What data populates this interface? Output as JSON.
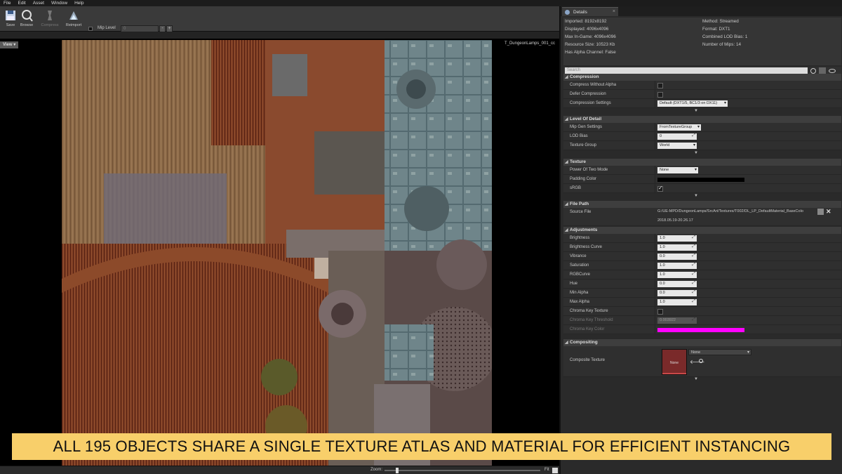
{
  "menu": [
    "File",
    "Edit",
    "Asset",
    "Window",
    "Help"
  ],
  "toolbar": {
    "save": "Save",
    "browse": "Browse",
    "compress": "Compress",
    "reimport": "Reimport",
    "mip_level_label": "Mip Level",
    "mip_level_value": "0"
  },
  "viewport": {
    "view_button": "View",
    "texture_name": "T_DungeonLamps_001_cc",
    "zoom_label": "Zoom:",
    "fit_label": "Fit"
  },
  "details": {
    "tab_label": "Details",
    "info": {
      "imported": "Imported: 8192x8192",
      "displayed": "Displayed: 4096x4096",
      "max_ingame": "Max In-Game: 4096x4096",
      "resource_size": "Resource Size: 10523 Kb",
      "has_alpha": "Has Alpha Channel: False",
      "method": "Method: Streamed",
      "format": "Format: DXT1",
      "lod_bias": "Combined LOD Bias: 1",
      "mips": "Number of Mips: 14"
    },
    "search_placeholder": "Search",
    "compression": {
      "title": "Compression",
      "compress_without_alpha": "Compress Without Alpha",
      "defer_compression": "Defer Compression",
      "compression_settings": "Compression Settings",
      "compression_settings_value": "Default (DXT1/5, BC1/3 on DX11)"
    },
    "lod": {
      "title": "Level Of Detail",
      "mip_gen": "Mip Gen Settings",
      "mip_gen_value": "FromTextureGroup",
      "lod_bias": "LOD Bias",
      "lod_bias_value": "0",
      "texture_group": "Texture Group",
      "texture_group_value": "World"
    },
    "texture": {
      "title": "Texture",
      "power_of_two": "Power Of Two Mode",
      "power_of_two_value": "None",
      "padding_color": "Padding Color",
      "srgb": "sRGB"
    },
    "file_path": {
      "title": "File Path",
      "source_file": "Source File",
      "path": "G:/UE-MPD/DungeonLamps/SrcArt/Textures/T002/DL_LP_DefaultMaterial_BaseColo",
      "date": "2018.05.19-20.26.17"
    },
    "adjustments": {
      "title": "Adjustments",
      "rows": [
        {
          "label": "Brightness",
          "value": "1.0"
        },
        {
          "label": "Brightness Curve",
          "value": "1.0"
        },
        {
          "label": "Vibrance",
          "value": "0.0"
        },
        {
          "label": "Saturation",
          "value": "1.0"
        },
        {
          "label": "RGBCurve",
          "value": "1.0"
        },
        {
          "label": "Hue",
          "value": "0.0"
        },
        {
          "label": "Min Alpha",
          "value": "0.0"
        },
        {
          "label": "Max Alpha",
          "value": "1.0"
        }
      ],
      "chroma_key_texture": "Chroma Key Texture",
      "chroma_key_threshold": "Chroma Key Threshold",
      "chroma_key_threshold_value": "0.003922",
      "chroma_key_color": "Chroma Key Color"
    },
    "compositing": {
      "title": "Compositing",
      "composite_texture": "Composite Texture",
      "thumb_label": "None",
      "combo_value": "None"
    }
  },
  "colors": {
    "padding_color": "#000000",
    "chroma_key_color": "#ff00ff",
    "caption_bg": "#f8cf6a"
  },
  "caption": "ALL 195 OBJECTS SHARE A SINGLE TEXTURE ATLAS AND MATERIAL FOR EFFICIENT INSTANCING"
}
